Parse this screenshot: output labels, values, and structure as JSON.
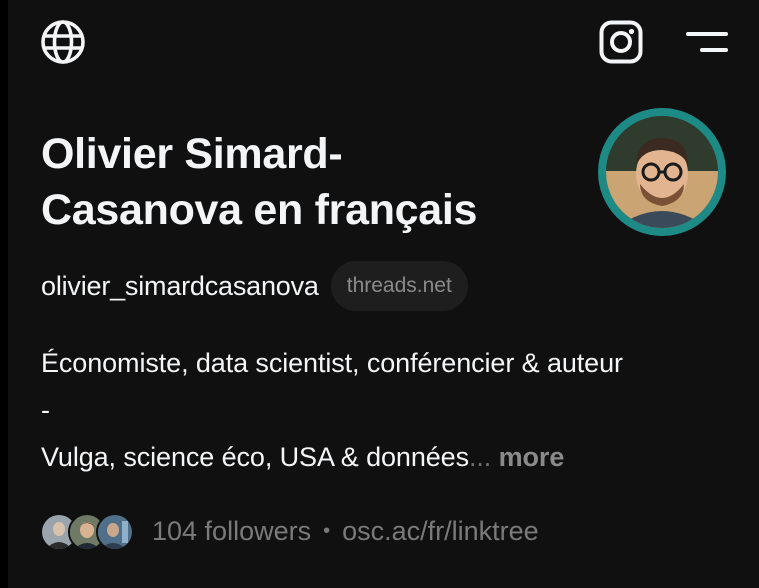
{
  "header": {
    "globe_icon": "globe-icon",
    "instagram_icon": "instagram-icon",
    "menu_icon": "menu-icon"
  },
  "profile": {
    "name_line1": "Olivier Simard-",
    "name_line2": "Casanova en français",
    "username": "olivier_simardcasanova",
    "domain_badge": "threads.net",
    "avatar_ring_color": "#1e8a86",
    "bio_line1": "Économiste, data scientist, conférencier & auteur",
    "bio_line2": "-",
    "bio_line3": "Vulga, science éco, USA & données",
    "bio_ellipsis": "...",
    "more_label": "more",
    "followers": "104 followers",
    "separator": "•",
    "link": "osc.ac/fr/linktree"
  }
}
